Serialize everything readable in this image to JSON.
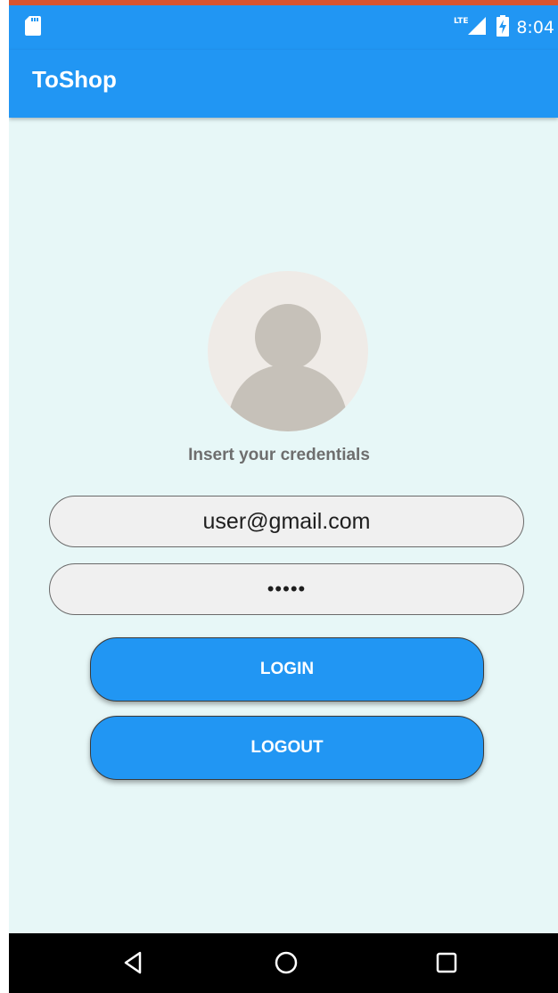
{
  "status_bar": {
    "time": "8:04",
    "network": "LTE",
    "icons": [
      "sd-card-icon",
      "lte-signal-icon",
      "battery-charging-icon"
    ]
  },
  "app_bar": {
    "title": "ToShop"
  },
  "login": {
    "avatar_icon": "person-icon",
    "prompt": "Insert your credentials",
    "email_value": "user@gmail.com",
    "password_value": "•••••",
    "login_label": "LOGIN",
    "logout_label": "LOGOUT"
  },
  "nav_bar": {
    "buttons": [
      "back-icon",
      "home-icon",
      "recents-icon"
    ]
  },
  "colors": {
    "primary": "#2196f3",
    "background": "#e7f7f7",
    "field_background": "#f0f0f0",
    "accent_top": "#d9542e"
  }
}
